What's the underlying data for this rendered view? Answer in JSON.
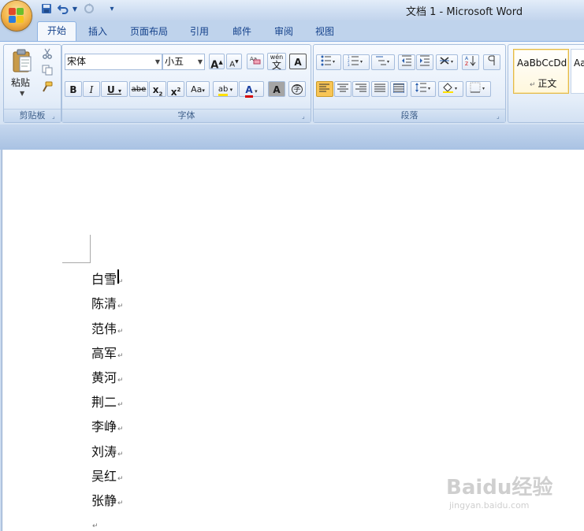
{
  "window": {
    "title": "文档 1 - Microsoft Word"
  },
  "quick_access": {
    "save_icon": "save-icon",
    "undo_icon": "undo-icon",
    "redo_icon": "redo-icon",
    "customize_icon": "customize-qat-icon"
  },
  "tabs": [
    {
      "label": "开始",
      "active": true
    },
    {
      "label": "插入"
    },
    {
      "label": "页面布局"
    },
    {
      "label": "引用"
    },
    {
      "label": "邮件"
    },
    {
      "label": "审阅"
    },
    {
      "label": "视图"
    }
  ],
  "clipboard": {
    "group_label": "剪贴板",
    "paste_label": "粘贴"
  },
  "font": {
    "group_label": "字体",
    "font_name": "宋体",
    "font_size": "小五",
    "grow": "A",
    "shrink": "A",
    "phonetic": "wén",
    "phonetic_char": "文",
    "char_border": "A",
    "bold": "B",
    "italic": "I",
    "underline": "U",
    "strike": "abe",
    "subscript": "x",
    "superscript": "x",
    "change_case": "Aa",
    "highlight": "ab",
    "font_color": "A",
    "char_shading": "A",
    "enclose": "字"
  },
  "paragraph": {
    "group_label": "段落"
  },
  "styles": {
    "normal_preview": "AaBbCcDd",
    "normal_name": "正文",
    "next_preview": "Aa"
  },
  "document": {
    "lines": [
      "白雪",
      "陈清",
      "范伟",
      "高军",
      "黄河",
      "荆二",
      "李峥",
      "刘涛",
      "吴红",
      "张静",
      ""
    ],
    "paragraph_mark": "↵"
  },
  "watermark": {
    "logo": "Baidu经验",
    "url": "jingyan.baidu.com"
  },
  "colors": {
    "accent": "#15428b",
    "highlight_yellow": "#ffe100",
    "font_red": "#d40000",
    "active_btn": "#f8c555"
  }
}
